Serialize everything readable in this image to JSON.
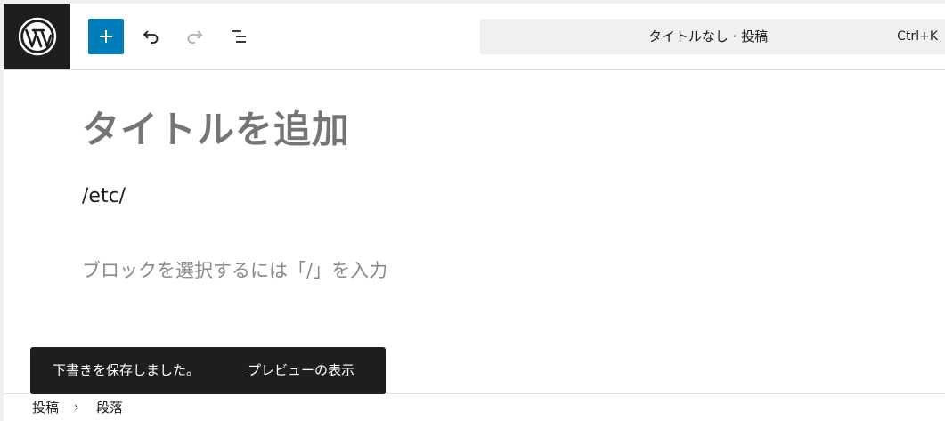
{
  "toolbar": {
    "logo_icon": "wordpress-logo-icon",
    "inserter_icon": "plus-icon",
    "undo_icon": "undo-icon",
    "redo_icon": "redo-icon",
    "list_view_icon": "list-view-icon"
  },
  "command_bar": {
    "title": "タイトルなし · 投稿",
    "shortcut": "Ctrl+K"
  },
  "editor": {
    "title_placeholder": "タイトルを追加",
    "paragraph_text": "/etc/",
    "block_placeholder": "ブロックを選択するには「/」を入力"
  },
  "snackbar": {
    "message": "下書きを保存しました。",
    "action_label": "プレビューの表示"
  },
  "breadcrumb": {
    "items": [
      "投稿",
      "段落"
    ],
    "separator": "›"
  },
  "colors": {
    "accent": "#007cba",
    "dark": "#1e1e1e",
    "placeholder": "#757575"
  }
}
